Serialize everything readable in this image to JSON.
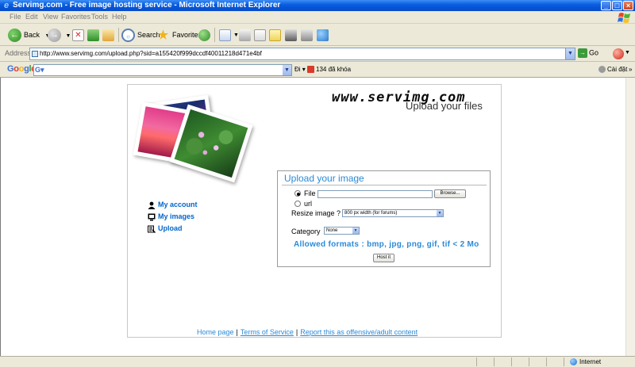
{
  "window": {
    "title": "Servimg.com - Free image hosting service - Microsoft Internet Explorer",
    "controls": {
      "minimize": "_",
      "maximize": "□",
      "close": "×"
    }
  },
  "menu": {
    "items": [
      "File",
      "Edit",
      "View",
      "Favorites",
      "Tools",
      "Help"
    ]
  },
  "toolbar": {
    "back_label": "Back",
    "search_label": "Search",
    "favorites_label": "Favorites"
  },
  "address": {
    "label": "Address",
    "url": "http://www.servimg.com/upload.php?sid=a155420f999dccdf40011218d471e4bf",
    "go_label": "Go"
  },
  "google_bar": {
    "logo": "Google",
    "search_value": "",
    "go_label": "Đi",
    "blocked_label": "134 đã khóa",
    "settings_label": "Cài đặt"
  },
  "page": {
    "brand": "www.servimg.com",
    "tagline": "Upload your files",
    "nav": [
      {
        "label": "My account",
        "icon": "user-icon"
      },
      {
        "label": "My images",
        "icon": "monitor-icon"
      },
      {
        "label": "Upload",
        "icon": "upload-icon"
      }
    ],
    "form": {
      "title": "Upload your image",
      "file_label": "File",
      "file_value": "",
      "browse_label": "Browse...",
      "url_label": "url",
      "resize_label": "Resize image ?",
      "resize_value": "800 px width (for forums)",
      "category_label": "Category",
      "category_value": "None",
      "formats_text": "Allowed formats : bmp, jpg, png, gif, tif < 2 Mo",
      "submit_label": "Host it"
    },
    "footer": {
      "home": "Home page",
      "terms": "Terms of Service",
      "report": "Report this as offensive/adult content"
    }
  },
  "status": {
    "text": "",
    "zone": "Internet"
  }
}
